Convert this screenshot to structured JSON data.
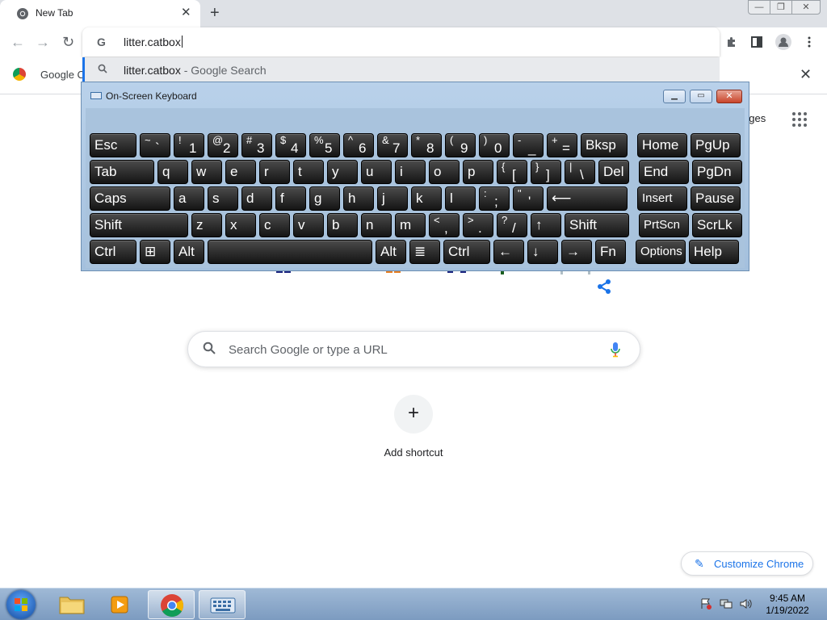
{
  "browser": {
    "tab_title": "New Tab",
    "tab_close": "✕",
    "new_tab": "+",
    "omnibox_text": "litter.catbox",
    "suggestion": {
      "primary": "litter.catbox",
      "secondary": " - Google Search"
    },
    "bookmark_label": "Google C",
    "window_controls": {
      "minimize": "—",
      "maximize": "❐",
      "close": "✕"
    }
  },
  "ntp": {
    "images_link": "ages",
    "search_placeholder": "Search Google or type a URL",
    "shortcut_plus": "+",
    "add_shortcut": "Add shortcut",
    "customize": "Customize Chrome"
  },
  "osk": {
    "title": "On-Screen Keyboard",
    "rows": [
      [
        {
          "id": "esc",
          "label": "Esc"
        },
        {
          "id": "tilde",
          "shift": "~",
          "main": "`"
        },
        {
          "id": "1",
          "shift": "!",
          "main": "1"
        },
        {
          "id": "2",
          "shift": "@",
          "main": "2"
        },
        {
          "id": "3",
          "shift": "#",
          "main": "3"
        },
        {
          "id": "4",
          "shift": "$",
          "main": "4"
        },
        {
          "id": "5",
          "shift": "%",
          "main": "5"
        },
        {
          "id": "6",
          "shift": "^",
          "main": "6"
        },
        {
          "id": "7",
          "shift": "&",
          "main": "7"
        },
        {
          "id": "8",
          "shift": "*",
          "main": "8"
        },
        {
          "id": "9",
          "shift": "(",
          "main": "9"
        },
        {
          "id": "0",
          "shift": ")",
          "main": "0"
        },
        {
          "id": "minus",
          "shift": "-",
          "main": "_"
        },
        {
          "id": "equal",
          "shift": "+",
          "main": "="
        },
        {
          "id": "bksp",
          "label": "Bksp"
        },
        {
          "id": "home",
          "label": "Home"
        },
        {
          "id": "pgup",
          "label": "PgUp"
        }
      ],
      [
        {
          "id": "tab",
          "label": "Tab"
        },
        {
          "id": "q",
          "label": "q"
        },
        {
          "id": "w",
          "label": "w"
        },
        {
          "id": "e",
          "label": "e"
        },
        {
          "id": "r",
          "label": "r"
        },
        {
          "id": "t",
          "label": "t"
        },
        {
          "id": "y",
          "label": "y"
        },
        {
          "id": "u",
          "label": "u"
        },
        {
          "id": "i",
          "label": "i"
        },
        {
          "id": "o",
          "label": "o"
        },
        {
          "id": "p",
          "label": "p"
        },
        {
          "id": "lbracket",
          "shift": "{",
          "main": "["
        },
        {
          "id": "rbracket",
          "shift": "}",
          "main": "]"
        },
        {
          "id": "backslash",
          "shift": "|",
          "main": "\\"
        },
        {
          "id": "del",
          "label": "Del"
        },
        {
          "id": "end",
          "label": "End"
        },
        {
          "id": "pgdn",
          "label": "PgDn"
        }
      ],
      [
        {
          "id": "caps",
          "label": "Caps"
        },
        {
          "id": "a",
          "label": "a"
        },
        {
          "id": "s",
          "label": "s"
        },
        {
          "id": "d",
          "label": "d"
        },
        {
          "id": "f",
          "label": "f"
        },
        {
          "id": "g",
          "label": "g"
        },
        {
          "id": "h",
          "label": "h"
        },
        {
          "id": "j",
          "label": "j"
        },
        {
          "id": "k",
          "label": "k"
        },
        {
          "id": "l",
          "label": "l"
        },
        {
          "id": "semicolon",
          "shift": ":",
          "main": ";"
        },
        {
          "id": "quote",
          "shift": "\"",
          "main": "'"
        },
        {
          "id": "enter",
          "label": "⟵"
        },
        {
          "id": "insert",
          "label": "Insert"
        },
        {
          "id": "pause",
          "label": "Pause"
        }
      ],
      [
        {
          "id": "lshift",
          "label": "Shift"
        },
        {
          "id": "z",
          "label": "z"
        },
        {
          "id": "x",
          "label": "x"
        },
        {
          "id": "c",
          "label": "c"
        },
        {
          "id": "v",
          "label": "v"
        },
        {
          "id": "b",
          "label": "b"
        },
        {
          "id": "n",
          "label": "n"
        },
        {
          "id": "m",
          "label": "m"
        },
        {
          "id": "comma",
          "shift": "<",
          "main": ","
        },
        {
          "id": "period",
          "shift": ">",
          "main": "."
        },
        {
          "id": "slash",
          "shift": "?",
          "main": "/"
        },
        {
          "id": "up",
          "label": "↑"
        },
        {
          "id": "rshift",
          "label": "Shift"
        },
        {
          "id": "prtscn",
          "label": "PrtScn"
        },
        {
          "id": "scrlk",
          "label": "ScrLk"
        }
      ],
      [
        {
          "id": "lctrl",
          "label": "Ctrl"
        },
        {
          "id": "win",
          "label": "⊞"
        },
        {
          "id": "lalt",
          "label": "Alt"
        },
        {
          "id": "space",
          "label": ""
        },
        {
          "id": "ralt",
          "label": "Alt"
        },
        {
          "id": "menu",
          "label": "≣"
        },
        {
          "id": "rctrl",
          "label": "Ctrl"
        },
        {
          "id": "left",
          "label": "←"
        },
        {
          "id": "down",
          "label": "↓"
        },
        {
          "id": "right",
          "label": "→"
        },
        {
          "id": "fn",
          "label": "Fn"
        },
        {
          "id": "options",
          "label": "Options"
        },
        {
          "id": "help",
          "label": "Help"
        }
      ]
    ]
  },
  "taskbar": {
    "time": "9:45 AM",
    "date": "1/19/2022"
  }
}
